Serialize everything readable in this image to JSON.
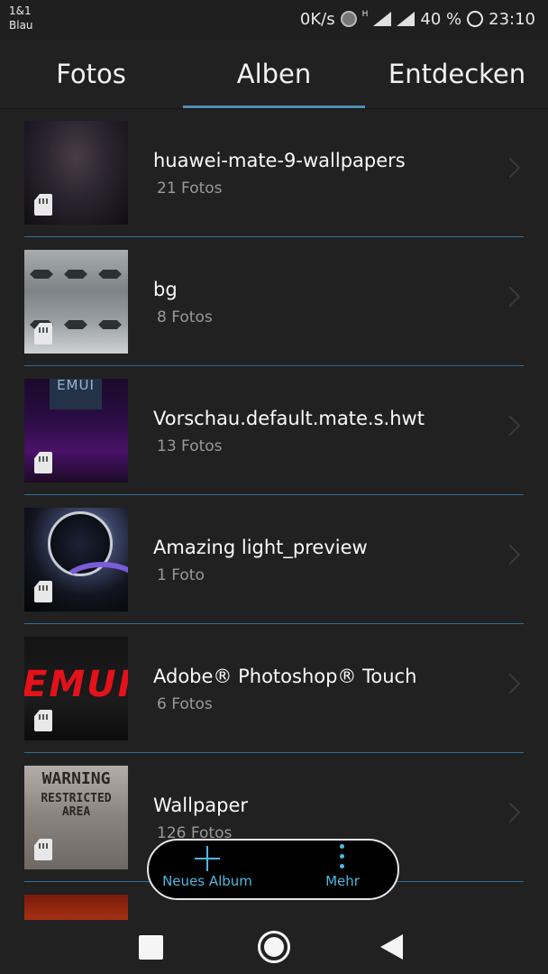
{
  "status_bar": {
    "carrier_line1": "1&1",
    "carrier_line2": "Blau",
    "net_speed": "0K/s",
    "network_type": "H",
    "battery": "40 %",
    "time": "23:10"
  },
  "tabs": [
    {
      "label": "Fotos",
      "active": false
    },
    {
      "label": "Alben",
      "active": true
    },
    {
      "label": "Entdecken",
      "active": false
    }
  ],
  "albums": [
    {
      "title": "huawei-mate-9-wallpapers",
      "count": "21 Fotos"
    },
    {
      "title": "bg",
      "count": "8 Fotos"
    },
    {
      "title": "Vorschau.default.mate.s.hwt",
      "count": "13 Fotos",
      "thumb_text": "EMUI"
    },
    {
      "title": "Amazing light_preview",
      "count": "1 Foto"
    },
    {
      "title": "Adobe® Photoshop® Touch",
      "count": "6 Fotos",
      "thumb_text": "EMUI"
    },
    {
      "title": "Wallpaper",
      "count": "126 Fotos",
      "thumb_text_1": "WARNING",
      "thumb_text_2": "RESTRICTED AREA"
    }
  ],
  "fab": {
    "new_album_label": "Neues Album",
    "more_label": "Mehr"
  },
  "colors": {
    "accent": "#4fb8e0",
    "divider": "#2f6f99",
    "background": "#212121"
  },
  "icons": {
    "sd_card": "sd-card-icon",
    "chevron": "chevron-right-icon",
    "add": "plus-icon",
    "more": "more-vertical-icon"
  }
}
